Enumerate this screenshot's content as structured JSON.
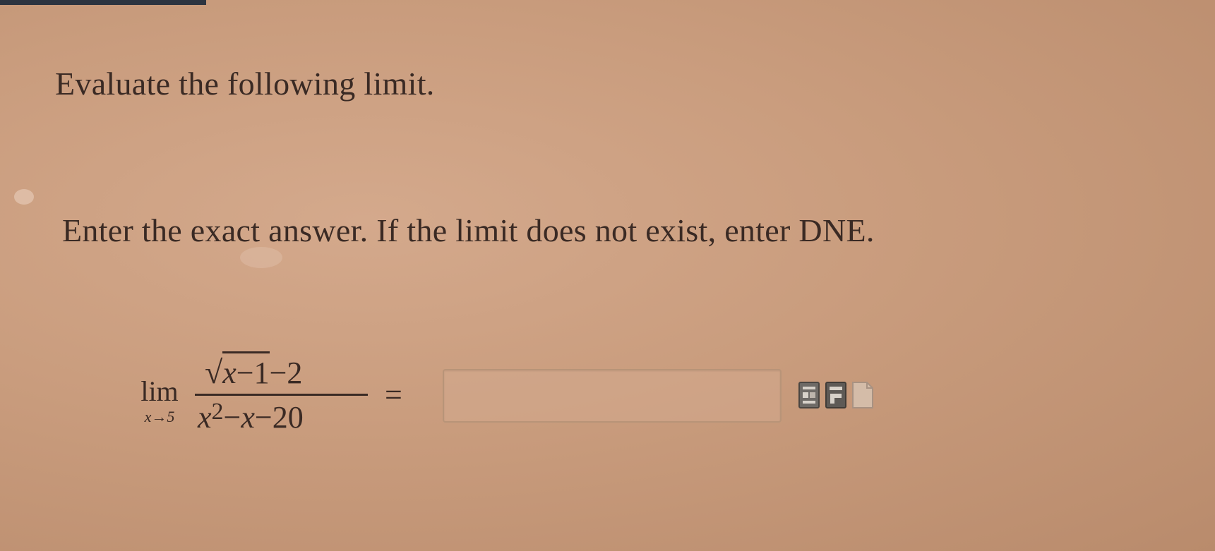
{
  "question": {
    "prompt": "Evaluate the following limit.",
    "instructions": "Enter the exact answer. If the limit does not exist, enter DNE."
  },
  "expression": {
    "lim_word": "lim",
    "lim_subscript": "x→5",
    "numerator": {
      "radicand_var": "x",
      "radicand_op": "−",
      "radicand_num": "1",
      "tail": "−2"
    },
    "denominator": {
      "base": "x",
      "exponent": "2",
      "rest_op1": "−",
      "rest_var": "x",
      "rest_op2": "−",
      "rest_num": "20"
    },
    "equals": "="
  },
  "answer": {
    "value": ""
  },
  "tools": [
    {
      "icon": "equation-editor-icon"
    },
    {
      "icon": "formula-template-icon"
    },
    {
      "icon": "blank-document-icon"
    }
  ]
}
